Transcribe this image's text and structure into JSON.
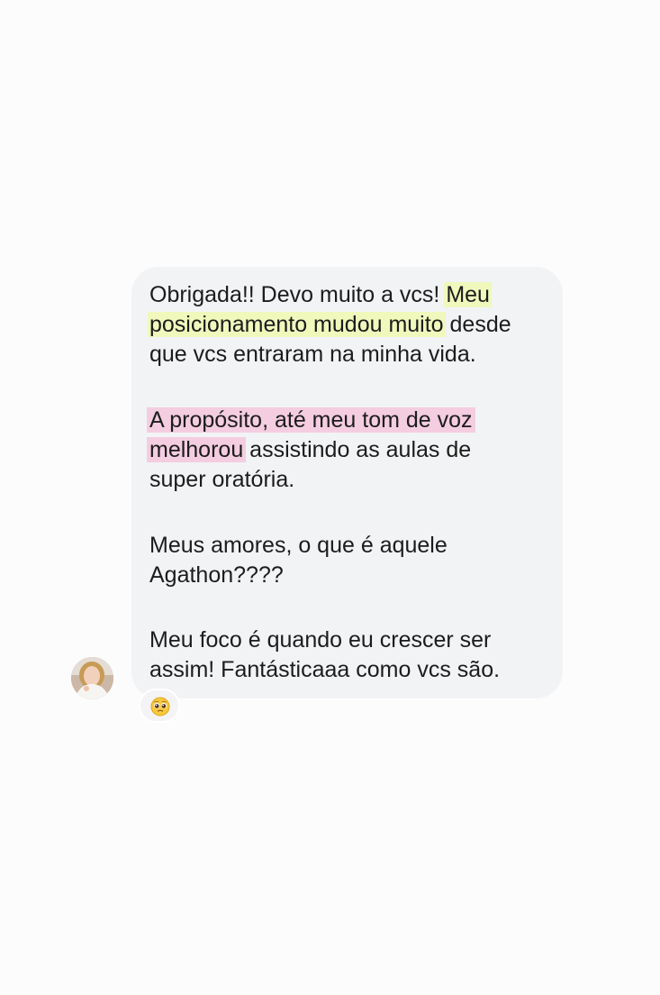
{
  "conversation": {
    "message": {
      "paragraph1": {
        "line1_plain": "Obrigada!! Devo muito a vcs! ",
        "line1_highlight": "Meu",
        "line2_highlight": "posicionamento mudou muito",
        "line2_plain": " desde",
        "line3": "que vcs entraram na minha vida."
      },
      "paragraph2": {
        "line1_highlight": "A propósito, até meu tom de voz",
        "line2_highlight": "melhorou",
        "line2_plain": " assistindo as aulas de",
        "line3": "super oratória."
      },
      "paragraph3": {
        "line1": "Meus amores, o que é aquele",
        "line2": "Agathon????"
      },
      "paragraph4": {
        "line1": "Meu foco é quando eu crescer ser",
        "line2": "assim! Fantásticaaa como vcs são."
      }
    },
    "reaction": {
      "icon": "pleading-face-emoji"
    },
    "avatar": {
      "icon": "user-avatar"
    },
    "colors": {
      "bubble": "#f2f3f5",
      "highlight_yellow": "#f0f8bc",
      "highlight_pink": "#f4cde0",
      "text": "#1c1c1c"
    }
  }
}
